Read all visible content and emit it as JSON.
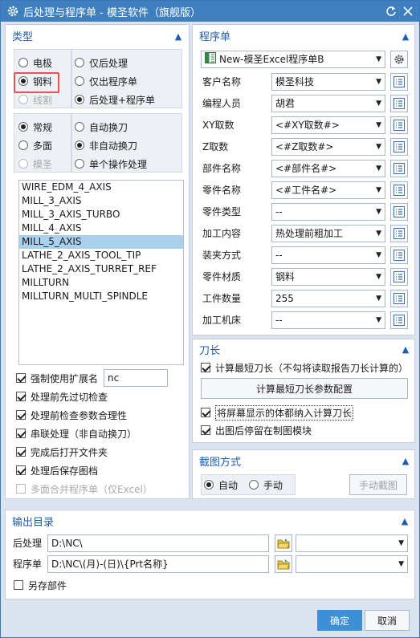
{
  "window": {
    "title": "后处理与程序单 - 模圣软件（旗舰版）",
    "icon": "gear-icon"
  },
  "type_section": {
    "title": "类型",
    "material": [
      {
        "label": "电极",
        "checked": false,
        "disabled": false
      },
      {
        "label": "钢料",
        "checked": true,
        "disabled": false
      },
      {
        "label": "线割",
        "checked": false,
        "disabled": true
      }
    ],
    "output_mode": [
      {
        "label": "仅后处理",
        "checked": false
      },
      {
        "label": "仅出程序单",
        "checked": false
      },
      {
        "label": "后处理+程序单",
        "checked": true
      }
    ],
    "scope": [
      {
        "label": "常规",
        "checked": true,
        "disabled": false
      },
      {
        "label": "多面",
        "checked": false,
        "disabled": false
      },
      {
        "label": "模圣",
        "checked": false,
        "disabled": true
      }
    ],
    "toolchange": [
      {
        "label": "自动换刀",
        "checked": false
      },
      {
        "label": "非自动换刀",
        "checked": true
      },
      {
        "label": "单个操作处理",
        "checked": false
      }
    ],
    "postprocessors": [
      "WIRE_EDM_4_AXIS",
      "MILL_3_AXIS",
      "MILL_3_AXIS_TURBO",
      "MILL_4_AXIS",
      "MILL_5_AXIS",
      "LATHE_2_AXIS_TOOL_TIP",
      "LATHE_2_AXIS_TURRET_REF",
      "MILLTURN",
      "MILLTURN_MULTI_SPINDLE"
    ],
    "selected_postprocessor": "MILL_5_AXIS",
    "force_ext_label": "强制使用扩展名",
    "force_ext_value": "nc",
    "options": [
      {
        "label": "处理前先过切检查",
        "checked": true,
        "disabled": false
      },
      {
        "label": "处理前检查参数合理性",
        "checked": true,
        "disabled": false
      },
      {
        "label": "串联处理（非自动换刀）",
        "checked": true,
        "disabled": false
      },
      {
        "label": "完成后打开文件夹",
        "checked": true,
        "disabled": false
      },
      {
        "label": "处理后保存图档",
        "checked": true,
        "disabled": false
      },
      {
        "label": "多面合并程序单（仅Excel）",
        "checked": false,
        "disabled": true
      }
    ]
  },
  "sheet_section": {
    "title": "程序单",
    "template": "New-模圣Excel程序单B",
    "fields": [
      {
        "label": "客户名称",
        "value": "模圣科技"
      },
      {
        "label": "编程人员",
        "value": "胡君"
      },
      {
        "label": "XY取数",
        "value": "<#XY取数#>"
      },
      {
        "label": "Z取数",
        "value": "<#Z取数#>"
      },
      {
        "label": "部件名称",
        "value": "<#部件名#>"
      },
      {
        "label": "零件名称",
        "value": "<#工件名#>"
      },
      {
        "label": "零件类型",
        "value": "--"
      },
      {
        "label": "加工内容",
        "value": "热处理前粗加工"
      },
      {
        "label": "装夹方式",
        "value": "--"
      },
      {
        "label": "零件材质",
        "value": "钢料"
      },
      {
        "label": "工件数量",
        "value": "255"
      },
      {
        "label": "加工机床",
        "value": "--"
      }
    ]
  },
  "tool_section": {
    "title": "刀长",
    "calc_label": "计算最短刀长（不勾将读取报告刀长计算的）",
    "calc_checked": true,
    "config_button": "计算最短刀长参数配置",
    "include_label": "将屏幕显示的体都纳入计算刀长",
    "include_checked": true,
    "stay_label": "出图后停留在制图模块",
    "stay_checked": true
  },
  "capture_section": {
    "title": "截图方式",
    "auto_label": "自动",
    "auto_checked": true,
    "manual_label": "手动",
    "manual_checked": false,
    "manual_button": "手动截图"
  },
  "output_section": {
    "title": "输出目录",
    "post_label": "后处理",
    "post_path": "D:\\NC\\",
    "sheet_label": "程序单",
    "sheet_path": "D:\\NC\\(月)-(日)\\{Prt名称}",
    "save_part_label": "另存部件",
    "save_part_checked": false
  },
  "footer": {
    "ok": "确定",
    "cancel": "取消"
  },
  "colors": {
    "titlebar": "#3f7fc0",
    "accent": "#1f5ea8",
    "selection": "#a9d1ee",
    "ok_button": "#3f8fd6",
    "highlight_box": "#e8505a"
  }
}
